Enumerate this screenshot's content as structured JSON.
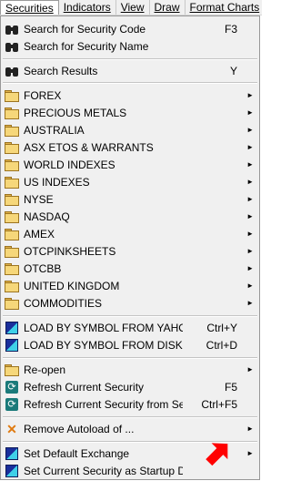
{
  "menubar": {
    "items": [
      "Securities",
      "Indicators",
      "View",
      "Draw",
      "Format Charts"
    ]
  },
  "menu": {
    "search_code": {
      "label": "Search for Security Code",
      "shortcut": "F3"
    },
    "search_name": {
      "label": "Search for Security Name"
    },
    "search_results": {
      "label": "Search Results",
      "shortcut": "Y"
    },
    "folders": [
      "FOREX",
      "PRECIOUS METALS",
      "AUSTRALIA",
      "ASX ETOS & WARRANTS",
      "WORLD INDEXES",
      "US INDEXES",
      "NYSE",
      "NASDAQ",
      "AMEX",
      "OTCPINKSHEETS",
      "OTCBB",
      "UNITED KINGDOM",
      "COMMODITIES"
    ],
    "load_yahoo": {
      "label": "LOAD BY SYMBOL FROM YAHOO",
      "shortcut": "Ctrl+Y"
    },
    "load_disk": {
      "label": "LOAD BY SYMBOL FROM DISK",
      "shortcut": "Ctrl+D"
    },
    "reopen": {
      "label": "Re-open"
    },
    "refresh_current": {
      "label": "Refresh Current Security",
      "shortcut": "F5"
    },
    "refresh_server": {
      "label": "Refresh Current Security from Server",
      "shortcut": "Ctrl+F5"
    },
    "remove_autoload": {
      "label": "Remove Autoload of ..."
    },
    "default_exchange": {
      "label": "Set Default Exchange"
    },
    "startup_default": {
      "label": "Set Current Security as Startup Default"
    }
  },
  "colors": {
    "accent_red": "#ff0000",
    "menu_bg": "#f0f0f0"
  }
}
